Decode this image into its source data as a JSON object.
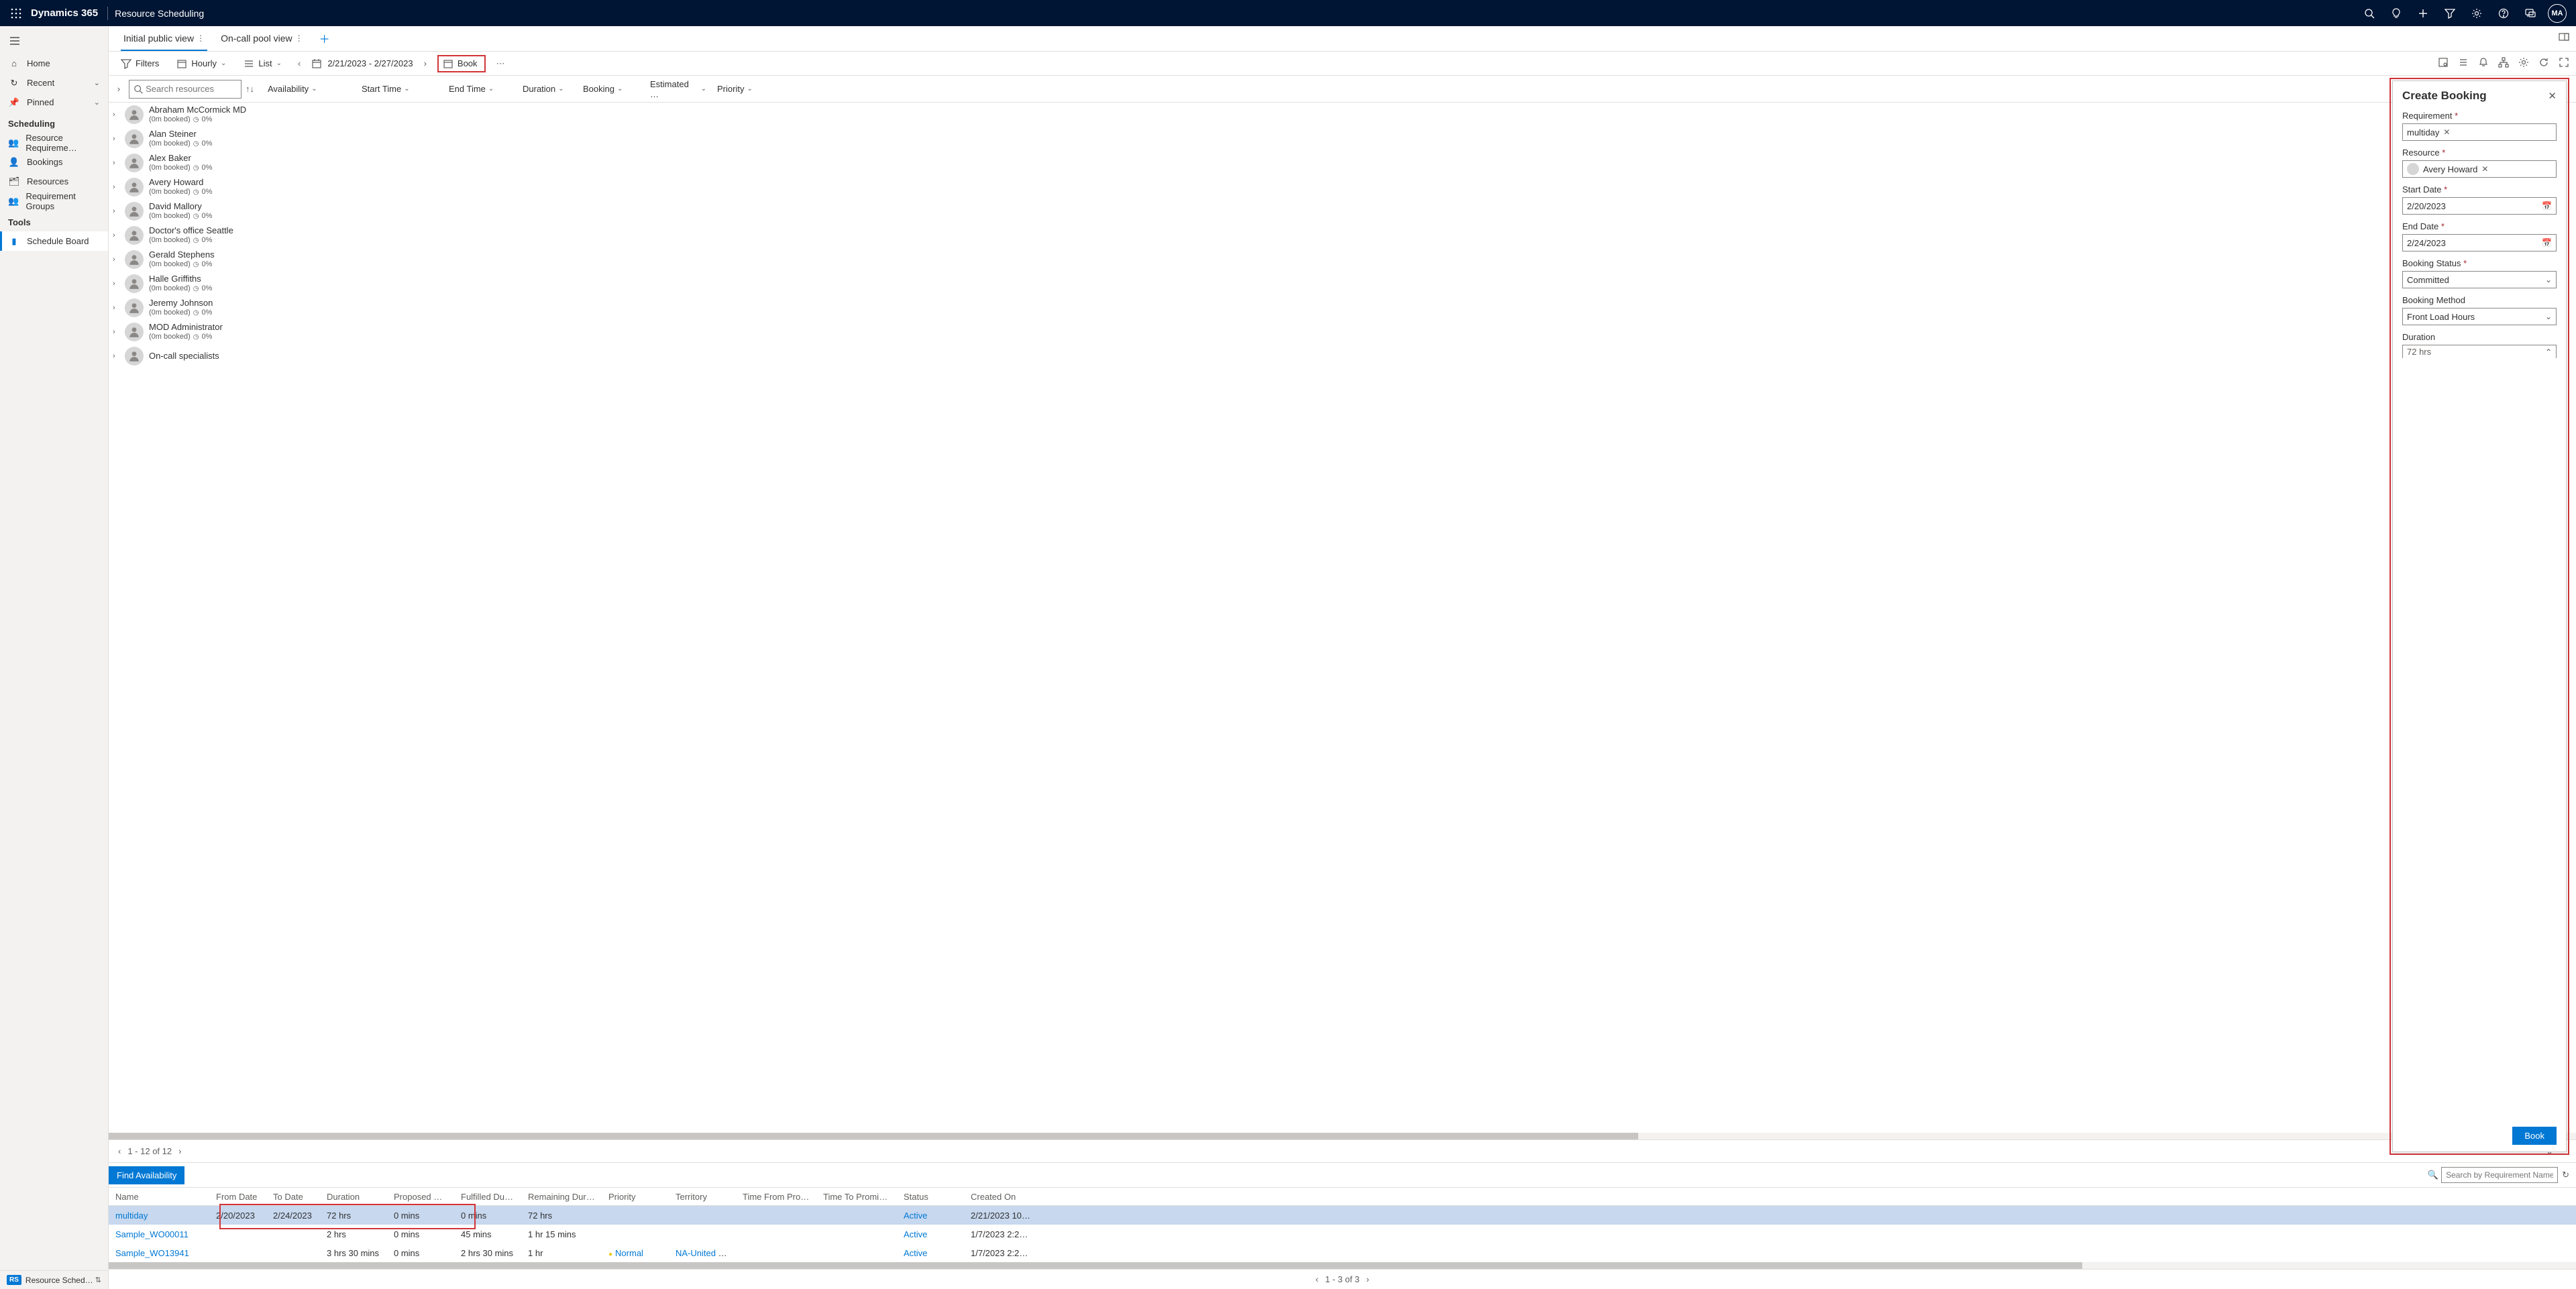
{
  "topbar": {
    "app": "Dynamics 365",
    "module": "Resource Scheduling",
    "avatar": "MA"
  },
  "sidebar": {
    "home": "Home",
    "recent": "Recent",
    "pinned": "Pinned",
    "section_scheduling": "Scheduling",
    "resource_req": "Resource Requireme…",
    "bookings": "Bookings",
    "resources": "Resources",
    "req_groups": "Requirement Groups",
    "section_tools": "Tools",
    "schedule_board": "Schedule Board",
    "footer_badge": "RS",
    "footer_text": "Resource Schedul…"
  },
  "tabs": {
    "initial": "Initial public view",
    "oncall": "On-call pool view"
  },
  "toolbar": {
    "filters": "Filters",
    "hourly": "Hourly",
    "list": "List",
    "date_range": "2/21/2023 - 2/27/2023",
    "book": "Book"
  },
  "columns": {
    "search_placeholder": "Search resources",
    "availability": "Availability",
    "start_time": "Start Time",
    "end_time": "End Time",
    "duration": "Duration",
    "booking": "Booking",
    "estimated": "Estimated …",
    "priority": "Priority"
  },
  "resources": [
    {
      "name": "Abraham McCormick MD",
      "sub": "(0m booked)",
      "pct": "0%"
    },
    {
      "name": "Alan Steiner",
      "sub": "(0m booked)",
      "pct": "0%"
    },
    {
      "name": "Alex Baker",
      "sub": "(0m booked)",
      "pct": "0%"
    },
    {
      "name": "Avery Howard",
      "sub": "(0m booked)",
      "pct": "0%"
    },
    {
      "name": "David Mallory",
      "sub": "(0m booked)",
      "pct": "0%"
    },
    {
      "name": "Doctor's office Seattle",
      "sub": "(0m booked)",
      "pct": "0%"
    },
    {
      "name": "Gerald Stephens",
      "sub": "(0m booked)",
      "pct": "0%"
    },
    {
      "name": "Halle Griffiths",
      "sub": "(0m booked)",
      "pct": "0%"
    },
    {
      "name": "Jeremy Johnson",
      "sub": "(0m booked)",
      "pct": "0%"
    },
    {
      "name": "MOD Administrator",
      "sub": "(0m booked)",
      "pct": "0%"
    },
    {
      "name": "On-call specialists",
      "sub": "",
      "pct": ""
    }
  ],
  "pager": "1 - 12 of 12",
  "bottom": {
    "find": "Find Availability",
    "search_placeholder": "Search by Requirement Name",
    "headers": {
      "name": "Name",
      "from": "From Date",
      "to": "To Date",
      "dur": "Duration",
      "prop": "Proposed Dur…",
      "ful": "Fulfilled Durat…",
      "rem": "Remaining Duration",
      "pri": "Priority",
      "terr": "Territory",
      "tfp": "Time From Promis…",
      "ttp": "Time To Promised",
      "stat": "Status",
      "cre": "Created On"
    },
    "rows": [
      {
        "name": "multiday",
        "from": "2/20/2023",
        "to": "2/24/2023",
        "dur": "72 hrs",
        "prop": "0 mins",
        "ful": "0 mins",
        "rem": "72 hrs",
        "pri": "",
        "terr": "",
        "tfp": "",
        "ttp": "",
        "stat": "Active",
        "cre": "2/21/2023 10:01 A…",
        "sel": true
      },
      {
        "name": "Sample_WO00011",
        "from": "",
        "to": "",
        "dur": "2 hrs",
        "prop": "0 mins",
        "ful": "45 mins",
        "rem": "1 hr 15 mins",
        "pri": "",
        "terr": "",
        "tfp": "",
        "ttp": "",
        "stat": "Active",
        "cre": "1/7/2023 2:20 PM",
        "sel": false
      },
      {
        "name": "Sample_WO13941",
        "from": "",
        "to": "",
        "dur": "3 hrs 30 mins",
        "prop": "0 mins",
        "ful": "2 hrs 30 mins",
        "rem": "1 hr",
        "pri": "Normal",
        "terr": "NA-United Sta…",
        "tfp": "",
        "ttp": "",
        "stat": "Active",
        "cre": "1/7/2023 2:20 PM",
        "sel": false
      }
    ],
    "pager": "1 - 3 of 3"
  },
  "panel": {
    "title": "Create Booking",
    "req_label": "Requirement",
    "req_value": "multiday",
    "res_label": "Resource",
    "res_value": "Avery Howard",
    "start_label": "Start Date",
    "start_value": "2/20/2023",
    "end_label": "End Date",
    "end_value": "2/24/2023",
    "status_label": "Booking Status",
    "status_value": "Committed",
    "method_label": "Booking Method",
    "method_value": "Front Load Hours",
    "dur_label": "Duration",
    "dur_value": "72 hrs",
    "book_btn": "Book"
  }
}
